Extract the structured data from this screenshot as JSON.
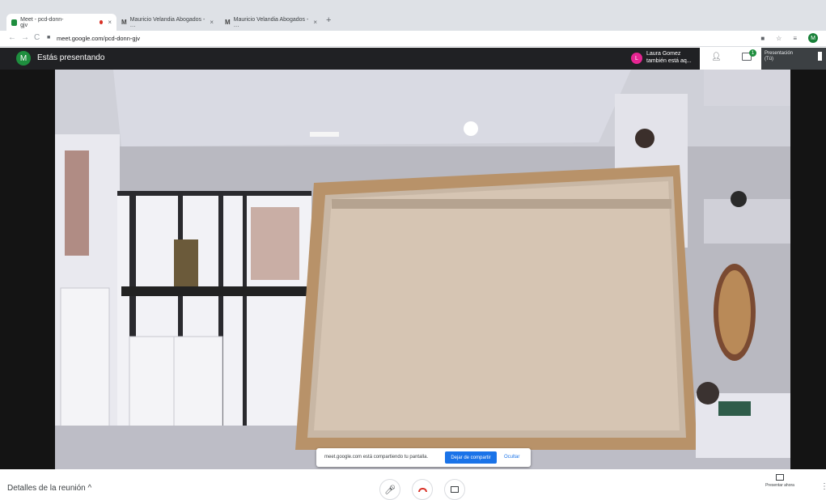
{
  "tabs": [
    {
      "label": "Meet - pcd-donn-gjv",
      "close": "×"
    },
    {
      "label": "Mauricio Velandia Abogados - …",
      "close": "×"
    },
    {
      "label": "Mauricio Velandia Abogados - …",
      "close": "×"
    }
  ],
  "newtab": "+",
  "address": {
    "url": "meet.google.com/pcd-donn-gjv",
    "profile_initial": "M"
  },
  "header": {
    "avatar_initial": "M",
    "status": "Estás presentando"
  },
  "participant": {
    "initial": "L",
    "name": "Laura Gomez",
    "note": "también está aq..."
  },
  "chat_badge": "1",
  "presentation_label": "Presentación",
  "presentation_sub": "(Tú)",
  "sharebar": {
    "text": "meet.google.com está compartiendo tu pantalla.",
    "stop": "Dejar de compartir",
    "hide": "Ocultar"
  },
  "bottom": {
    "details": "Detalles de la reunión",
    "present_now": "Presentar ahora"
  },
  "colors": {
    "meet_dark": "#202124",
    "accent": "#1a73e8",
    "green": "#1e8e3e",
    "end_call": "#d93025"
  }
}
